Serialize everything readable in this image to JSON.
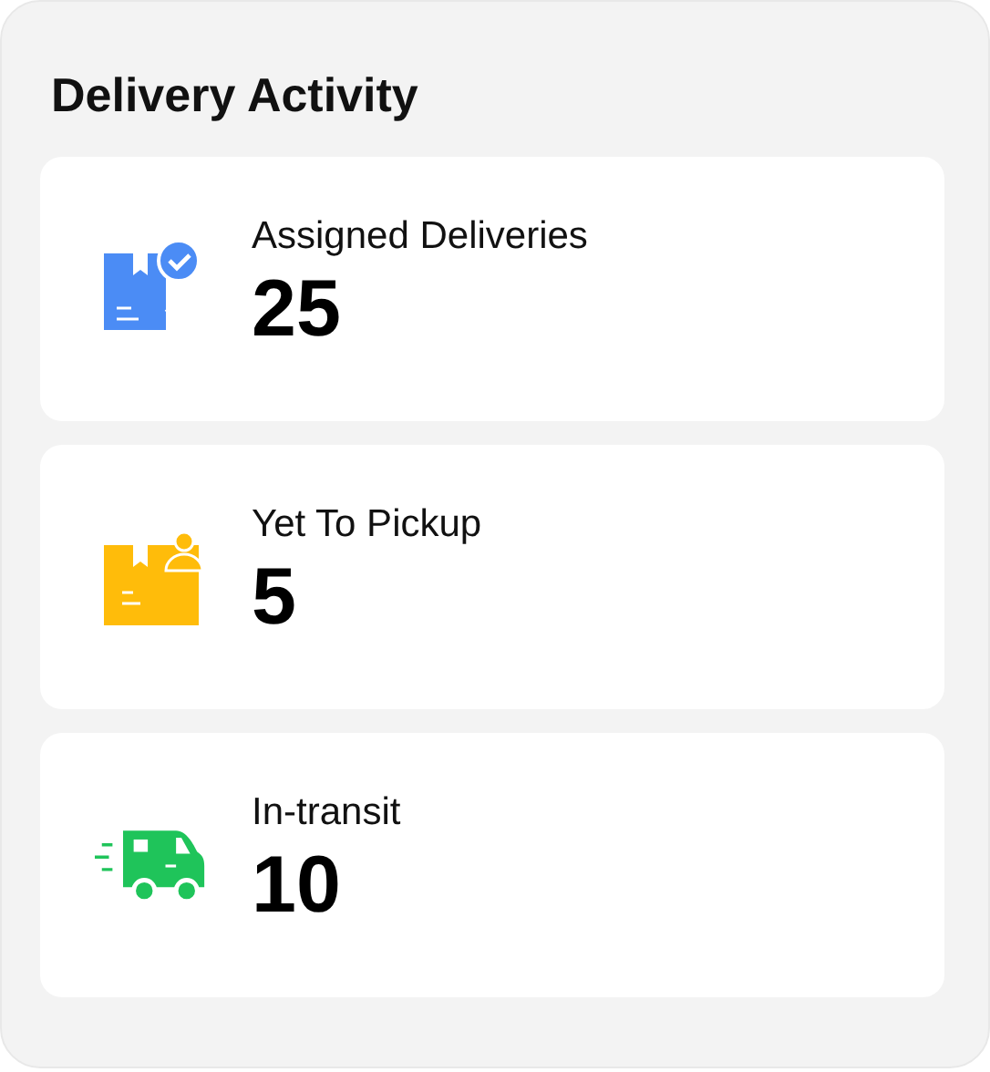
{
  "title": "Delivery Activity",
  "stats": [
    {
      "kind": "box-check",
      "color": "#4b8cf5",
      "label": "Assigned Deliveries",
      "value": "25"
    },
    {
      "kind": "box-person",
      "color": "#ffbc0a",
      "label": "Yet To Pickup",
      "value": "5"
    },
    {
      "kind": "truck",
      "color": "#1fc45a",
      "label": "In-transit",
      "value": "10"
    }
  ]
}
